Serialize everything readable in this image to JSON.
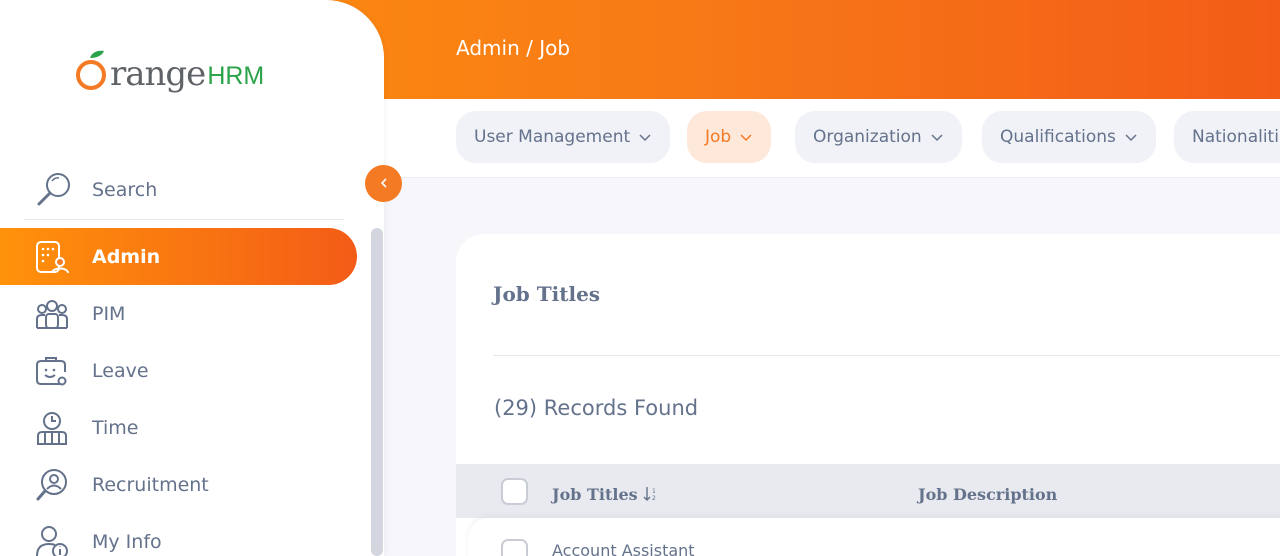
{
  "brand": {
    "logo_text": "rangeHRM",
    "logo_hrm": "HRM",
    "logo_word": "range",
    "logo_alt": "OrangeHRM"
  },
  "header": {
    "breadcrumb": "Admin / Job"
  },
  "subnav": {
    "tabs": [
      {
        "label": "User Management",
        "active": false
      },
      {
        "label": "Job",
        "active": true
      },
      {
        "label": "Organization",
        "active": false
      },
      {
        "label": "Qualifications",
        "active": false
      },
      {
        "label": "Nationalities",
        "active": false
      }
    ]
  },
  "sidebar": {
    "search_label": "Search",
    "items": [
      {
        "label": "Admin",
        "icon": "admin-icon",
        "active": true
      },
      {
        "label": "PIM",
        "icon": "pim-icon",
        "active": false
      },
      {
        "label": "Leave",
        "icon": "leave-icon",
        "active": false
      },
      {
        "label": "Time",
        "icon": "time-icon",
        "active": false
      },
      {
        "label": "Recruitment",
        "icon": "recruitment-icon",
        "active": false
      },
      {
        "label": "My Info",
        "icon": "my-info-icon",
        "active": false
      }
    ]
  },
  "main": {
    "title": "Job Titles",
    "records": "(29) Records Found",
    "table": {
      "columns": [
        "Job Titles",
        "Job Description"
      ],
      "rows": [
        {
          "job_title": "Account Assistant",
          "job_description": ""
        }
      ]
    }
  },
  "colors": {
    "accent": "#f47a24",
    "accent_light": "#fde8d9",
    "text": "#64728c"
  }
}
